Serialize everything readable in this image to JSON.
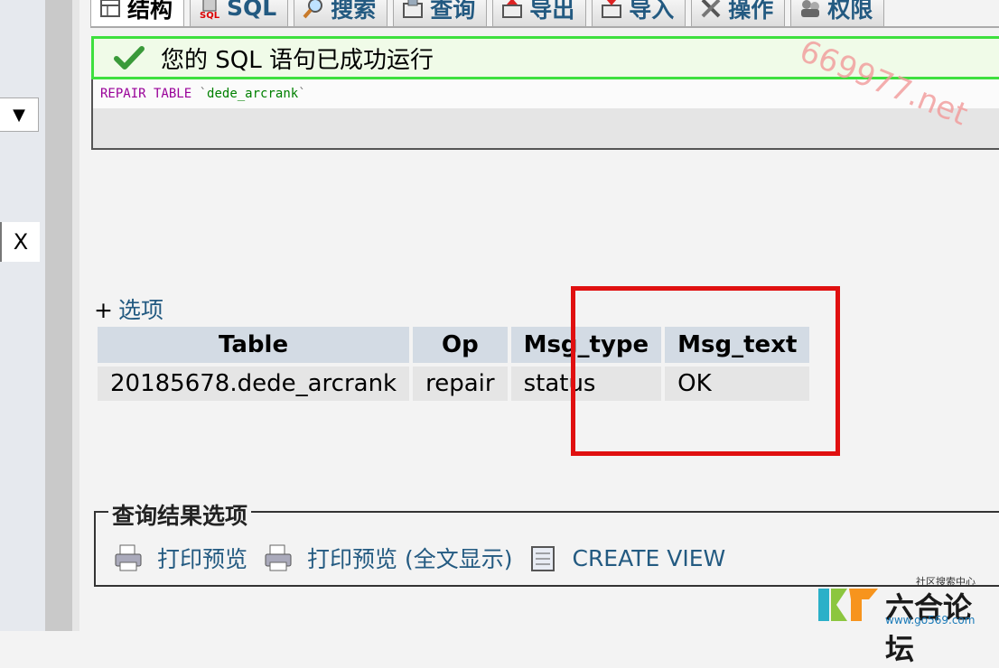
{
  "nav": {
    "select_arrow": "▼",
    "clear_button": "X"
  },
  "tabs": [
    {
      "label": "结构",
      "icon": "table-structure-icon",
      "active": true
    },
    {
      "label": "SQL",
      "icon": "sql-icon"
    },
    {
      "label": "搜索",
      "icon": "search-icon"
    },
    {
      "label": "查询",
      "icon": "query-icon"
    },
    {
      "label": "导出",
      "icon": "export-icon"
    },
    {
      "label": "导入",
      "icon": "import-icon"
    },
    {
      "label": "操作",
      "icon": "tools-icon"
    },
    {
      "label": "权限",
      "icon": "privileges-icon"
    }
  ],
  "message": {
    "success_text": "您的 SQL 语句已成功运行",
    "sql_keyword": "REPAIR TABLE",
    "sql_table": "dede_arcrank"
  },
  "watermark": "669977.net",
  "options": {
    "plus": "+",
    "link": "选项"
  },
  "result": {
    "columns": [
      "Table",
      "Op",
      "Msg_type",
      "Msg_text"
    ],
    "rows": [
      [
        "20185678.dede_arcrank",
        "repair",
        "status",
        "OK"
      ]
    ]
  },
  "query_ops": {
    "legend": "查询结果选项",
    "items": [
      {
        "label": "打印预览",
        "icon": "print-icon"
      },
      {
        "label": "打印预览 (全文显示)",
        "icon": "print-icon"
      },
      {
        "label": "CREATE VIEW",
        "icon": "create-view-icon"
      }
    ]
  },
  "corner_logo": {
    "top_text": "社区搜索中心",
    "name": "六合论坛",
    "url": "www.go569.com"
  },
  "colors": {
    "success_border": "#3ee03e",
    "highlight": "#e01010",
    "link": "#235a81"
  }
}
